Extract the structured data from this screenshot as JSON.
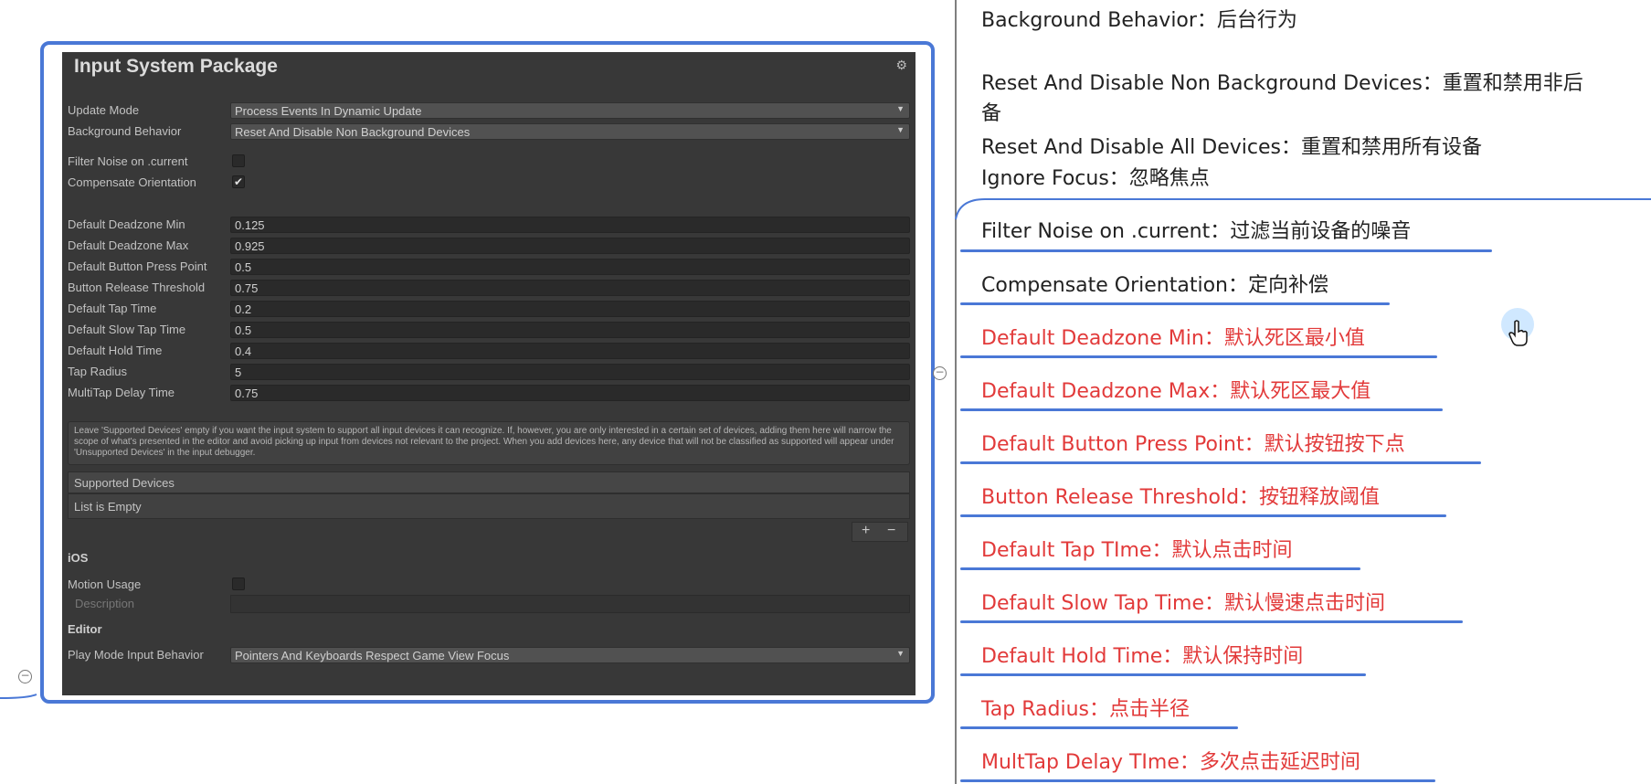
{
  "panel": {
    "title": "Input System Package",
    "rows": {
      "update_mode": {
        "label": "Update Mode",
        "value": "Process Events In Dynamic Update"
      },
      "background_behavior": {
        "label": "Background Behavior",
        "value": "Reset And Disable Non Background Devices"
      },
      "filter_noise": {
        "label": "Filter Noise on .current",
        "checked": ""
      },
      "compensate_orientation": {
        "label": "Compensate Orientation",
        "checked": "✔"
      },
      "deadzone_min": {
        "label": "Default Deadzone Min",
        "value": "0.125"
      },
      "deadzone_max": {
        "label": "Default Deadzone Max",
        "value": "0.925"
      },
      "button_press_point": {
        "label": "Default Button Press Point",
        "value": "0.5"
      },
      "button_release_threshold": {
        "label": "Button Release Threshold",
        "value": "0.75"
      },
      "tap_time": {
        "label": "Default Tap Time",
        "value": "0.2"
      },
      "slow_tap_time": {
        "label": "Default Slow Tap Time",
        "value": "0.5"
      },
      "hold_time": {
        "label": "Default Hold Time",
        "value": "0.4"
      },
      "tap_radius": {
        "label": "Tap Radius",
        "value": "5"
      },
      "multitap_delay": {
        "label": "MultiTap Delay Time",
        "value": "0.75"
      }
    },
    "supported_note": "Leave 'Supported Devices' empty if you want the input system to support all input devices it can recognize. If, however, you are only interested in a certain set of devices, adding them here will narrow the scope of what's presented in the editor and avoid picking up input from devices not relevant to the project. When you add devices here, any device that will not be classified as supported will appear under 'Unsupported Devices' in the input debugger.",
    "supported_devices_label": "Supported Devices",
    "list_empty": "List is Empty",
    "add_symbol": "+",
    "remove_symbol": "−",
    "ios_section": "iOS",
    "motion_usage_label": "Motion Usage",
    "description_label": "Description",
    "editor_section": "Editor",
    "play_mode_label": "Play Mode Input Behavior",
    "play_mode_value": "Pointers And Keyboards Respect Game View Focus"
  },
  "translations": {
    "background_behavior": "Background Behavior：后台行为",
    "reset_non_bg_line1": "Reset And Disable Non Background Devices：重置和禁用非后",
    "reset_non_bg_line2": "备",
    "reset_all": "Reset And Disable All Devices：重置和禁用所有设备",
    "ignore_focus": "Ignore Focus：忽略焦点",
    "filter_noise": "Filter Noise on .current：过滤当前设备的噪音",
    "compensate_orientation": "Compensate Orientation：定向补偿",
    "deadzone_min": "Default Deadzone Min：默认死区最小值",
    "deadzone_max": "Default Deadzone Max：默认死区最大值",
    "button_press_point": "Default Button Press Point：默认按钮按下点",
    "button_release_threshold": "Button Release Threshold：按钮释放阈值",
    "tap_time": "Default Tap TIme：默认点击时间",
    "slow_tap_time": "Default Slow Tap Time：默认慢速点击时间",
    "hold_time": "Default Hold Time：默认保持时间",
    "tap_radius": "Tap Radius：点击半径",
    "multitap_delay": "MultTap Delay TIme：多次点击延迟时间"
  },
  "colors": {
    "accent_blue": "#4a78d6",
    "highlight_red": "#e23a3a",
    "panel_bg": "#383838"
  },
  "icons": [
    "gear-icon",
    "collapse-icon",
    "hand-cursor-icon",
    "dropdown-caret-icon"
  ]
}
